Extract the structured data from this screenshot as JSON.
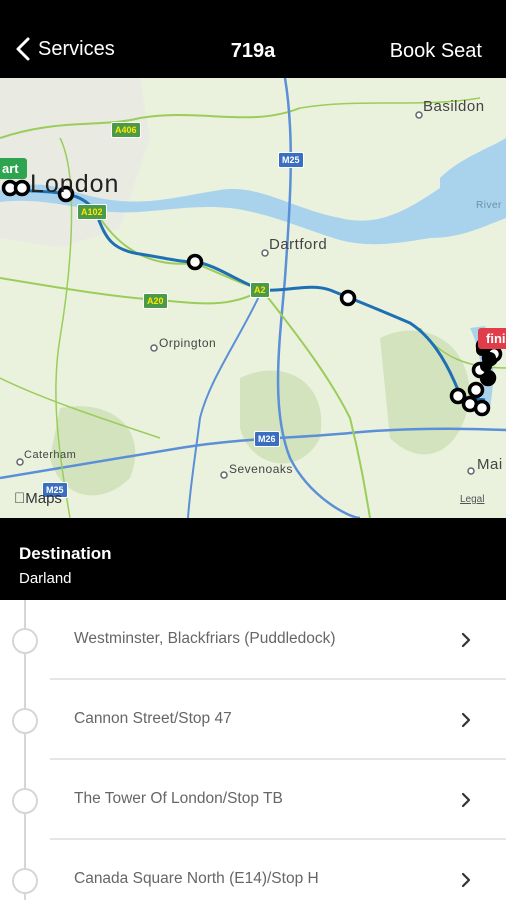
{
  "header": {
    "back_label": "Services",
    "title": "719a",
    "action_label": "Book Seat"
  },
  "map": {
    "labels": {
      "london": "London",
      "basildon": "Basildon",
      "dartford": "Dartford",
      "orpington": "Orpington",
      "caterham": "Caterham",
      "sevenoaks": "Sevenoaks",
      "river": "River",
      "maidstone": "Mai"
    },
    "roads": {
      "a406": "A406",
      "m25a": "M25",
      "a102": "A102",
      "a20": "A20",
      "a2": "A2",
      "m26": "M26",
      "m25b": "M25"
    },
    "start_tag": "art",
    "finish_tag": "fini",
    "provider": "Maps",
    "legal": "Legal",
    "route_color": "#1f6fb5",
    "stop_marker_color": "#000000"
  },
  "destination": {
    "label": "Destination",
    "value": "Darland"
  },
  "stops": [
    {
      "name": "Westminster, Blackfriars (Puddledock)"
    },
    {
      "name": "Cannon Street/Stop 47"
    },
    {
      "name": "The Tower Of London/Stop TB"
    },
    {
      "name": "Canada Square North (E14)/Stop H"
    }
  ]
}
